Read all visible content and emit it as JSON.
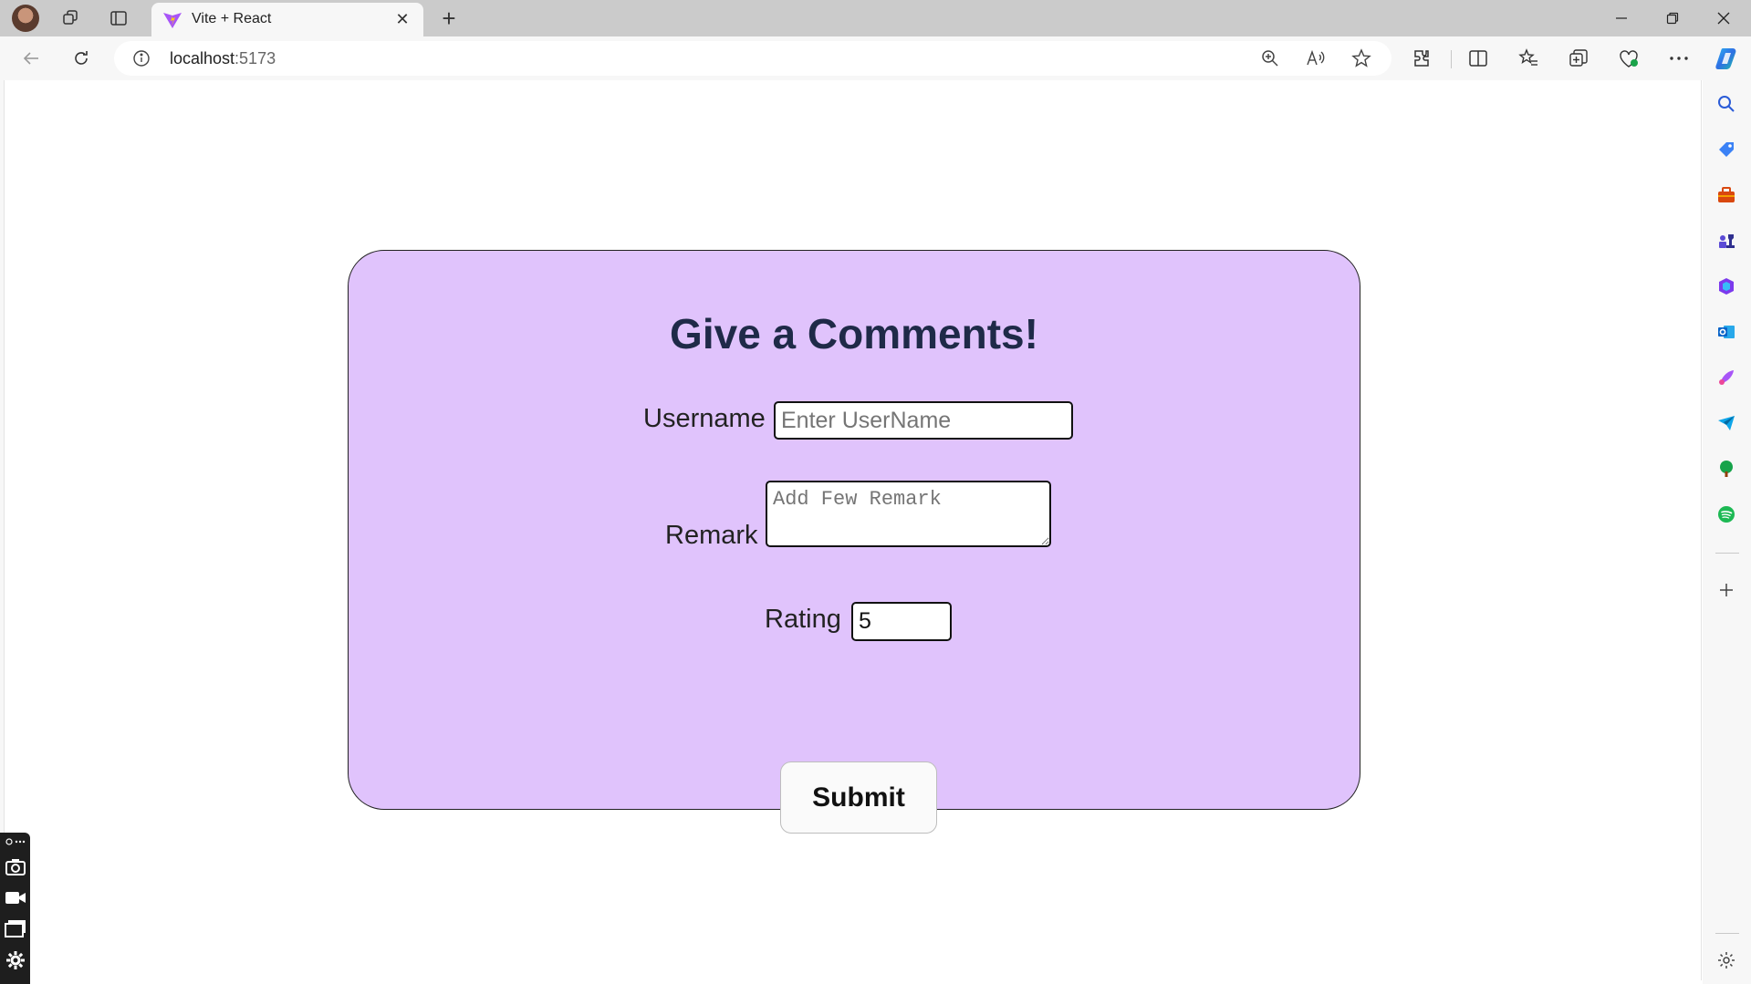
{
  "browser": {
    "tab": {
      "title": "Vite + React",
      "close_glyph": "✕"
    },
    "new_tab_glyph": "+",
    "address": {
      "host": "localhost",
      "port": ":5173"
    },
    "window": {
      "minimize": "—",
      "restore": "❐",
      "close": "✕"
    }
  },
  "form": {
    "heading": "Give a Comments!",
    "username": {
      "label": "Username",
      "placeholder": "Enter UserName",
      "value": ""
    },
    "remark": {
      "label": "Remark",
      "placeholder": "Add Few Remark",
      "value": ""
    },
    "rating": {
      "label": "Rating",
      "value": "5"
    },
    "submit_label": "Submit"
  },
  "colors": {
    "card_background": "#e0c3fc",
    "heading_color": "#1f2a48"
  },
  "sidebar_icons": [
    "search-icon",
    "tag-icon",
    "toolbox-icon",
    "chess-icon",
    "office-icon",
    "outlook-icon",
    "designer-icon",
    "send-icon",
    "tree-icon",
    "spotify-icon",
    "add-icon",
    "settings-icon"
  ]
}
